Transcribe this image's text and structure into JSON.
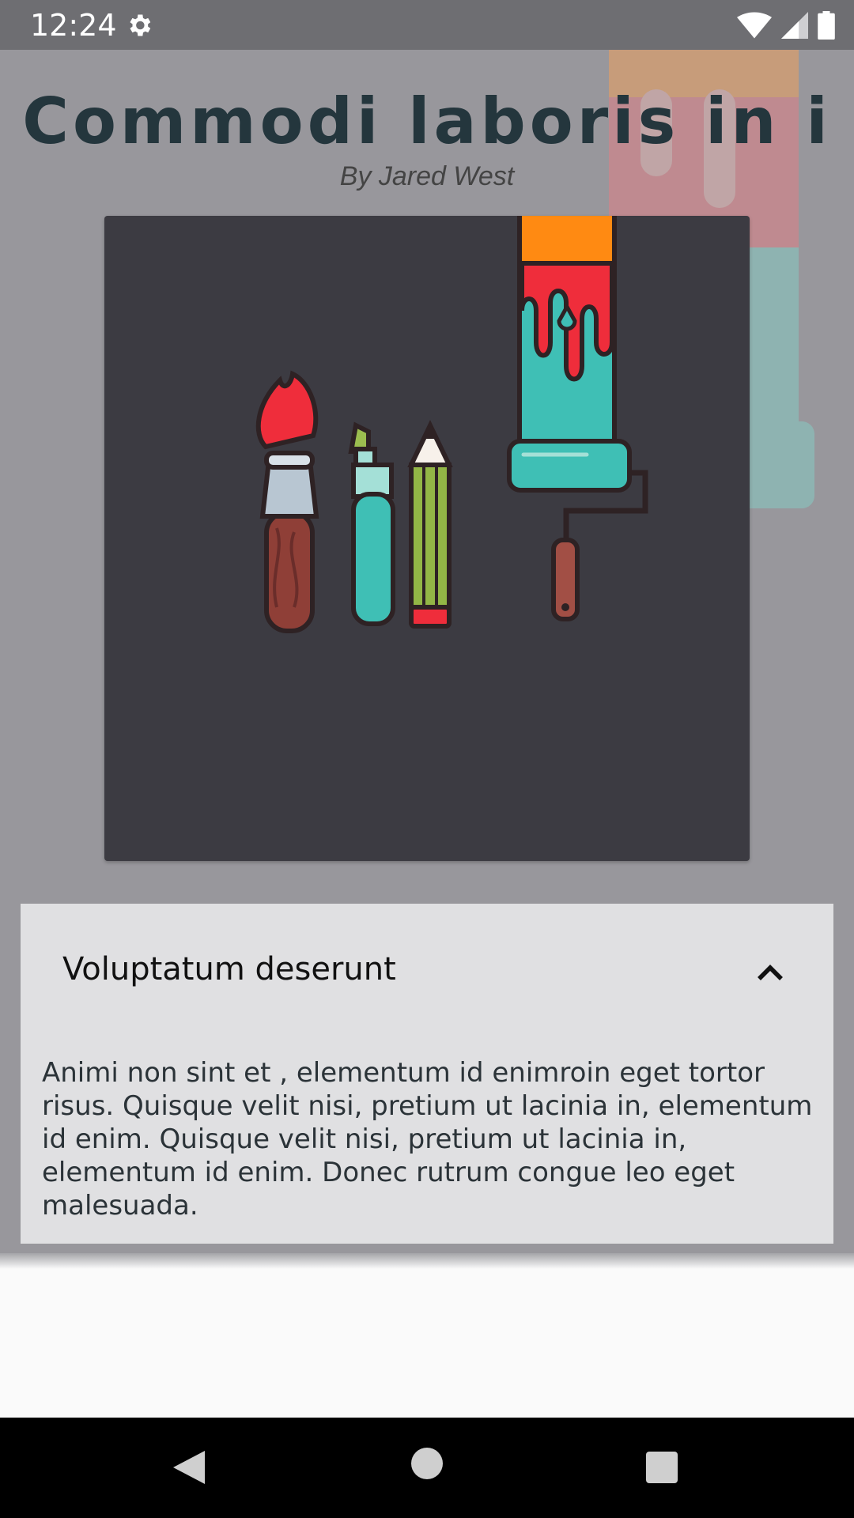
{
  "status": {
    "time": "12:24"
  },
  "article": {
    "title": "Commodi laboris in i",
    "byline": "By Jared West",
    "image": {
      "subject": "paint brush, highlighter, pencil and paint roller illustration"
    }
  },
  "panel": {
    "title": "Voluptatum deserunt",
    "expanded": true,
    "body": "Animi non sint et , elementum id enimroin eget tortor risus. Quisque velit nisi, pretium ut lacinia in, elementum id enim. Quisque velit nisi, pretium ut lacinia in, elementum id enim. Donec rutrum congue leo eget malesuada."
  },
  "icons": {
    "settings": "gear-icon",
    "wifi": "wifi-icon",
    "signal": "signal-icon",
    "battery": "battery-icon",
    "toggle": "chevron-up-icon",
    "back": "back-icon",
    "home": "home-icon",
    "recents": "recents-icon"
  },
  "colors": {
    "title": "#24363d",
    "card_bg": "#3c3b42",
    "panel_bg": "#e0e0e2",
    "scrim": "#98979c"
  }
}
